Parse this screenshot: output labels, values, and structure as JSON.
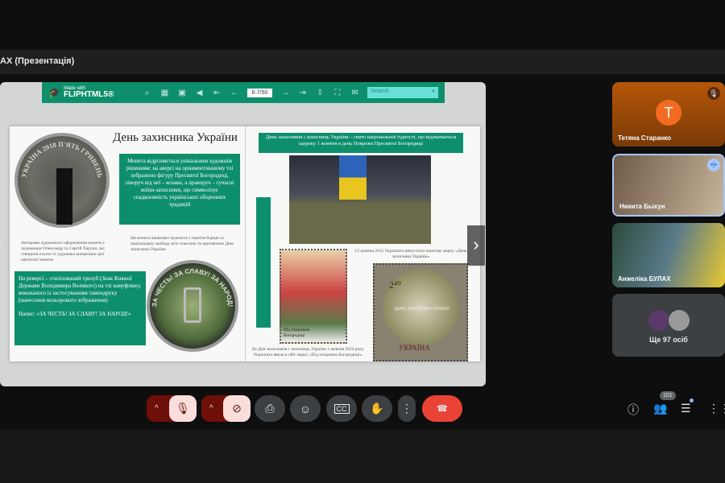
{
  "meeting": {
    "title": "АХ (Презентація)"
  },
  "toolbar": {
    "made_with": "Made with",
    "brand": "FLIPHTML5®",
    "page": "6-7/50",
    "search_placeholder": "Search",
    "icons": [
      "zoom-icon",
      "thumbnails-icon",
      "fit-icon",
      "sound-icon",
      "first-page-icon",
      "prev-page-icon",
      "next-page-icon",
      "last-page-icon",
      "share-icon",
      "fullscreen-icon",
      "mail-icon"
    ]
  },
  "left_page": {
    "heading": "День захисника України",
    "obverse": "Монета відрізняється унікальним художнім рішенням: на аверсі на орнаментованому тлі зображено фігуру Пресвятої Богородиці, ліворуч від неї – козаки, а праворуч – сучасні воїни-захисники, що символізує спадкоємність українських оборонних традицій",
    "authors": "Авторами художнього оформлення монети є художники Олександр та Сергій Харуки, які створили ескізи та художньо концепцію цієї пам'ятної монети",
    "honor": "Ця монета вшановує мужність і героїзм борців за національну свободу всіх поколінь та присвячена Дню захисника України",
    "reverse": "На реверсі – стилізований тризуб (Знак Княжої Держави Володимира Великого) на тлі камуфляжу, виконаного із застосуванням тамподруку (нанесення кольорового зображення)",
    "motto": "Напис: «ЗА ЧЕСТЬ! ЗА СЛАВУ! ЗА НАРОД!»",
    "coin1_text": "УКРАЇНА 2018 П'ЯТЬ ГРИВЕНЬ",
    "coin2_text": "ЗА ЧЕСТЬ! ЗА СЛАВУ! ЗА НАРОД!"
  },
  "right_page": {
    "banner": "День захисників і захисниць України – свято національної гідності, що відзначається щороку 1 жовтня в день Покрови Пресвятої Богородиці",
    "stamp2015_caption": "12 жовтня 2015 Укрпошта випустила поштову марку «День захисника України»",
    "stamp2024_caption": "До Дня захисників і захисниць України 1 жовтня 2024 року Укрпошта ввела в обіг марку «Під покровом Богородиці»",
    "stamp2024_text": "Під покровом Богородиці",
    "stamp2015_value": "2⁴⁰",
    "stamp2015_title": "ДЕНЬ ЗАХИСНИКА УКРАЇНИ",
    "stamp2015_country": "УКРАЇНА"
  },
  "participants": [
    {
      "name": "Тетяна Старанко",
      "initial": "Т",
      "muted": true
    },
    {
      "name": "Никита Быхун",
      "speaking": true
    },
    {
      "name": "Анжеліка БУЛАХ"
    }
  ],
  "more": {
    "label": "Ще 97 осіб"
  },
  "controls": {
    "participant_count": "101"
  },
  "colors": {
    "accent": "#0e8f6c",
    "end_call": "#ea4335",
    "muted": "#f9dedc",
    "avatar": "#f36c21"
  }
}
